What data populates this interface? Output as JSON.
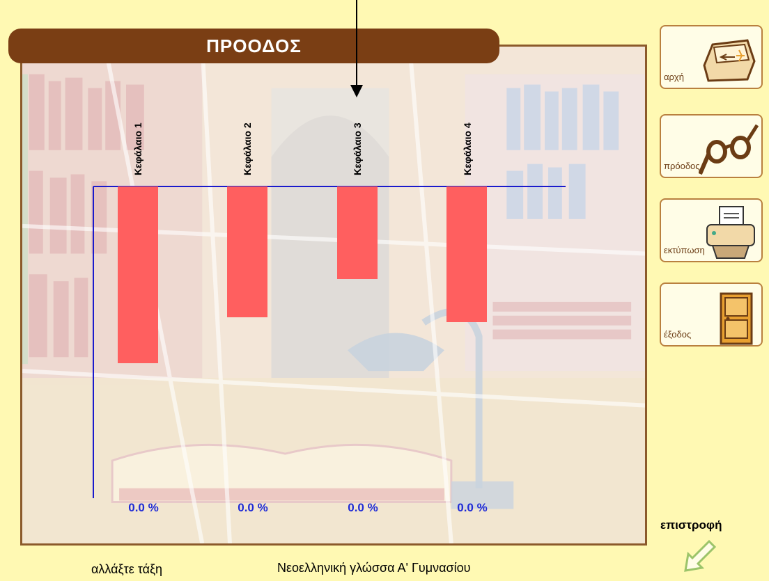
{
  "header": {
    "title": "ΠΡΟΟΔΟΣ"
  },
  "sidebar": {
    "items": [
      {
        "label": "αρχή",
        "icon": "keyboard-key-icon"
      },
      {
        "label": "πρόοδος",
        "icon": "glasses-icon"
      },
      {
        "label": "εκτύπωση",
        "icon": "printer-icon"
      },
      {
        "label": "έξοδος",
        "icon": "door-icon"
      }
    ]
  },
  "return": {
    "label": "επιστροφή",
    "icon": "back-arrow-icon"
  },
  "footer": {
    "change_class": "αλλάξτε τάξη",
    "course": "Νεοελληνική γλώσσα Α' Γυμνασίου"
  },
  "colors": {
    "bar": "#FF5F5F",
    "axis": "#1A1ACC",
    "title_bg": "#7A3E14",
    "percent_text": "#1F2BD6"
  },
  "chart_data": {
    "type": "bar",
    "categories": [
      "Κεφάλαιο 1",
      "Κεφάλαιο 2",
      "Κεφάλαιο 3",
      "Κεφάλαιο 4"
    ],
    "values": [
      0.0,
      0.0,
      0.0,
      0.0
    ],
    "value_labels": [
      "0.0 %",
      "0.0 %",
      "0.0 %",
      "0.0 %"
    ],
    "title": "",
    "xlabel": "",
    "ylabel": ""
  }
}
